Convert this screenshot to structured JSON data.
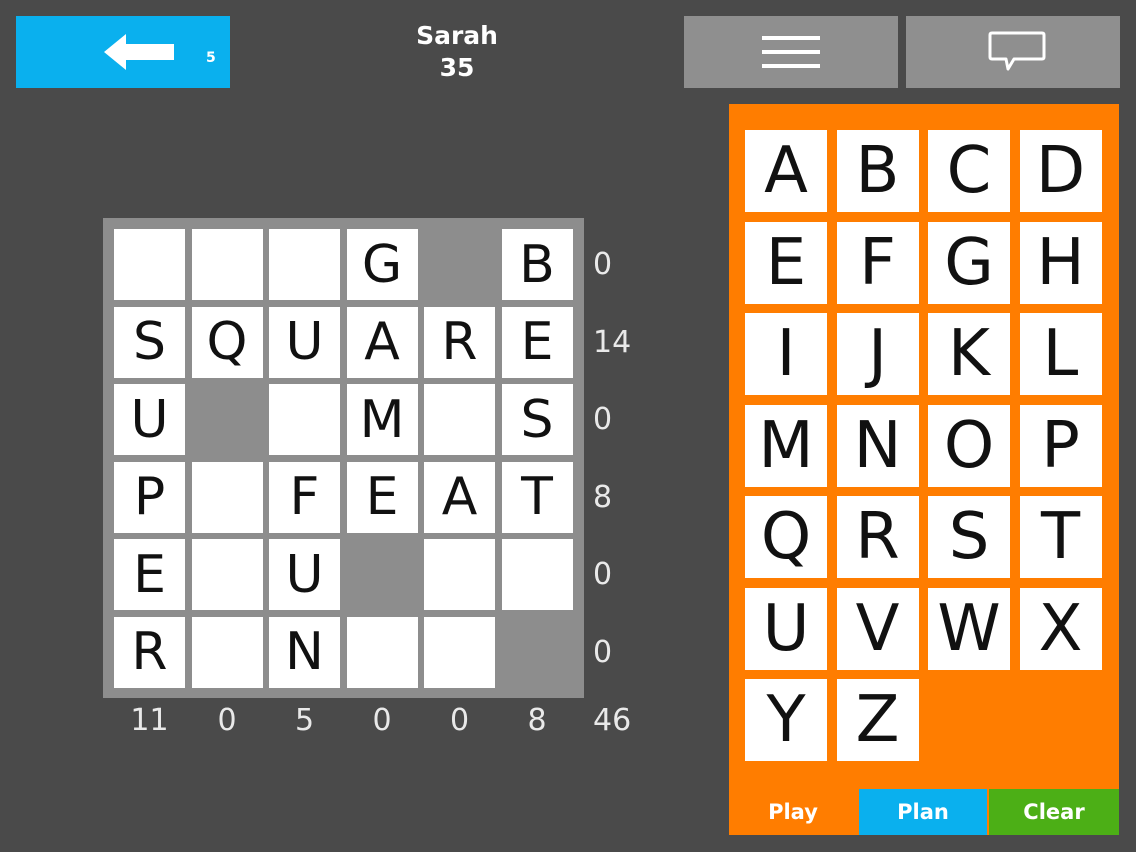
{
  "header": {
    "back_count": "5",
    "player_name": "Sarah",
    "player_score": "35"
  },
  "icons": {
    "back": "left-arrow-icon",
    "menu": "hamburger-menu-icon",
    "chat": "speech-bubble-icon"
  },
  "colors": {
    "background": "#4a4a4a",
    "blue": "#0ab0ee",
    "orange": "#ff7d00",
    "green": "#4caf16",
    "gray_button": "#8f8f8f",
    "board_gray": "#8d8d8d"
  },
  "board": {
    "grid": [
      [
        "",
        "",
        "",
        "G",
        "#",
        "B"
      ],
      [
        "S",
        "Q",
        "U",
        "A",
        "R",
        "E"
      ],
      [
        "U",
        "#",
        "",
        "M",
        "",
        "S"
      ],
      [
        "P",
        "",
        "F",
        "E",
        "A",
        "T"
      ],
      [
        "E",
        "",
        "U",
        "#",
        "",
        ""
      ],
      [
        "R",
        "",
        "N",
        "",
        "",
        "#"
      ]
    ],
    "row_scores": [
      "0",
      "14",
      "0",
      "8",
      "0",
      "0"
    ],
    "col_scores": [
      "11",
      "0",
      "5",
      "0",
      "0",
      "8"
    ],
    "total": "46"
  },
  "palette": {
    "letters": [
      "A",
      "B",
      "C",
      "D",
      "E",
      "F",
      "G",
      "H",
      "I",
      "J",
      "K",
      "L",
      "M",
      "N",
      "O",
      "P",
      "Q",
      "R",
      "S",
      "T",
      "U",
      "V",
      "W",
      "X",
      "Y",
      "Z"
    ]
  },
  "actions": {
    "play": "Play",
    "plan": "Plan",
    "clear": "Clear"
  }
}
